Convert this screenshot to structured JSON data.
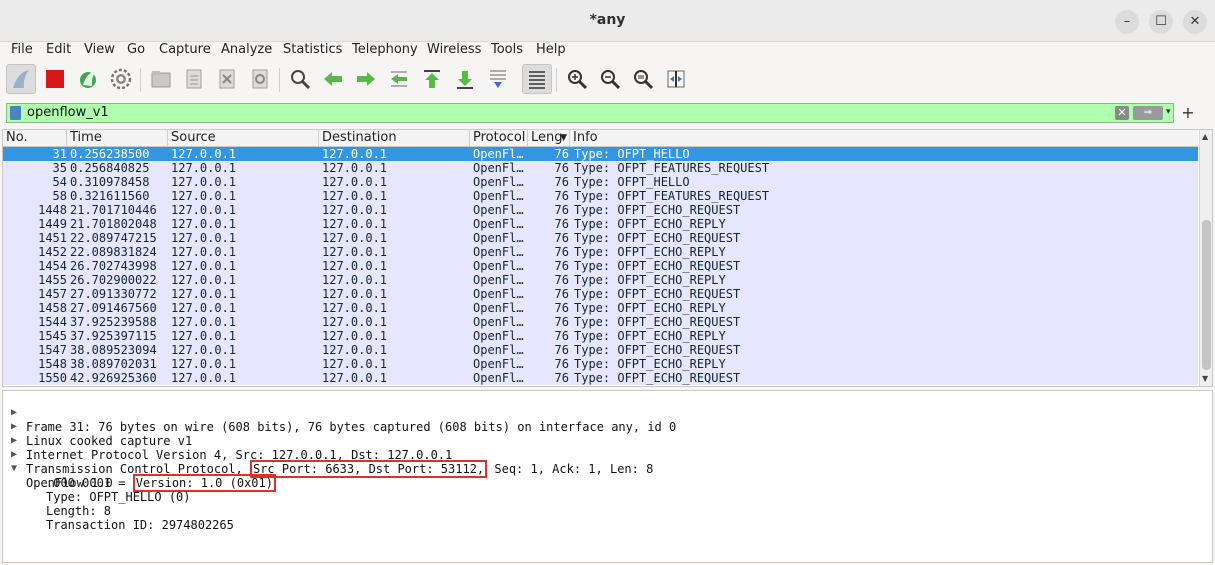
{
  "window": {
    "title": "*any",
    "minimize": "–",
    "maximize": "☐",
    "close": "✕"
  },
  "menu": [
    "File",
    "Edit",
    "View",
    "Go",
    "Capture",
    "Analyze",
    "Statistics",
    "Telephony",
    "Wireless",
    "Tools",
    "Help"
  ],
  "toolbar_icons": [
    "shark-fin-start-icon",
    "stop-square-icon",
    "restart-icon",
    "capture-options-gear-icon",
    "open-folder-icon",
    "save-file-icon",
    "close-file-icon",
    "reload-icon",
    "find-magnifier-icon",
    "go-back-icon",
    "go-forward-icon",
    "go-to-packet-icon",
    "first-packet-icon",
    "last-packet-icon",
    "autoscroll-icon",
    "colorize-icon",
    "zoom-in-icon",
    "zoom-out-icon",
    "zoom-normal-icon",
    "resize-columns-icon"
  ],
  "filter": {
    "value": "openflow_v1",
    "clear": "✕",
    "apply": "⇒",
    "dropdown": "▾",
    "add": "+"
  },
  "columns": [
    "No.",
    "Time",
    "Source",
    "Destination",
    "Protocol",
    "Leng",
    "Info"
  ],
  "rows": [
    {
      "no": "31",
      "time": "0.256238500",
      "src": "127.0.0.1",
      "dst": "127.0.0.1",
      "proto": "OpenFl…",
      "len": "76",
      "info": "Type: OFPT_HELLO",
      "selected": true
    },
    {
      "no": "35",
      "time": "0.256840825",
      "src": "127.0.0.1",
      "dst": "127.0.0.1",
      "proto": "OpenFl…",
      "len": "76",
      "info": "Type: OFPT_FEATURES_REQUEST"
    },
    {
      "no": "54",
      "time": "0.310978458",
      "src": "127.0.0.1",
      "dst": "127.0.0.1",
      "proto": "OpenFl…",
      "len": "76",
      "info": "Type: OFPT_HELLO"
    },
    {
      "no": "58",
      "time": "0.321611560",
      "src": "127.0.0.1",
      "dst": "127.0.0.1",
      "proto": "OpenFl…",
      "len": "76",
      "info": "Type: OFPT_FEATURES_REQUEST"
    },
    {
      "no": "1448",
      "time": "21.701710446",
      "src": "127.0.0.1",
      "dst": "127.0.0.1",
      "proto": "OpenFl…",
      "len": "76",
      "info": "Type: OFPT_ECHO_REQUEST"
    },
    {
      "no": "1449",
      "time": "21.701802048",
      "src": "127.0.0.1",
      "dst": "127.0.0.1",
      "proto": "OpenFl…",
      "len": "76",
      "info": "Type: OFPT_ECHO_REPLY"
    },
    {
      "no": "1451",
      "time": "22.089747215",
      "src": "127.0.0.1",
      "dst": "127.0.0.1",
      "proto": "OpenFl…",
      "len": "76",
      "info": "Type: OFPT_ECHO_REQUEST"
    },
    {
      "no": "1452",
      "time": "22.089831824",
      "src": "127.0.0.1",
      "dst": "127.0.0.1",
      "proto": "OpenFl…",
      "len": "76",
      "info": "Type: OFPT_ECHO_REPLY"
    },
    {
      "no": "1454",
      "time": "26.702743998",
      "src": "127.0.0.1",
      "dst": "127.0.0.1",
      "proto": "OpenFl…",
      "len": "76",
      "info": "Type: OFPT_ECHO_REQUEST"
    },
    {
      "no": "1455",
      "time": "26.702900022",
      "src": "127.0.0.1",
      "dst": "127.0.0.1",
      "proto": "OpenFl…",
      "len": "76",
      "info": "Type: OFPT_ECHO_REPLY"
    },
    {
      "no": "1457",
      "time": "27.091330772",
      "src": "127.0.0.1",
      "dst": "127.0.0.1",
      "proto": "OpenFl…",
      "len": "76",
      "info": "Type: OFPT_ECHO_REQUEST"
    },
    {
      "no": "1458",
      "time": "27.091467560",
      "src": "127.0.0.1",
      "dst": "127.0.0.1",
      "proto": "OpenFl…",
      "len": "76",
      "info": "Type: OFPT_ECHO_REPLY"
    },
    {
      "no": "1544",
      "time": "37.925239588",
      "src": "127.0.0.1",
      "dst": "127.0.0.1",
      "proto": "OpenFl…",
      "len": "76",
      "info": "Type: OFPT_ECHO_REQUEST"
    },
    {
      "no": "1545",
      "time": "37.925397115",
      "src": "127.0.0.1",
      "dst": "127.0.0.1",
      "proto": "OpenFl…",
      "len": "76",
      "info": "Type: OFPT_ECHO_REPLY"
    },
    {
      "no": "1547",
      "time": "38.089523094",
      "src": "127.0.0.1",
      "dst": "127.0.0.1",
      "proto": "OpenFl…",
      "len": "76",
      "info": "Type: OFPT_ECHO_REQUEST"
    },
    {
      "no": "1548",
      "time": "38.089702031",
      "src": "127.0.0.1",
      "dst": "127.0.0.1",
      "proto": "OpenFl…",
      "len": "76",
      "info": "Type: OFPT_ECHO_REPLY"
    },
    {
      "no": "1550",
      "time": "42.926925360",
      "src": "127.0.0.1",
      "dst": "127.0.0.1",
      "proto": "OpenFl…",
      "len": "76",
      "info": "Type: OFPT_ECHO_REQUEST"
    }
  ],
  "details": {
    "frame": "Frame 31: 76 bytes on wire (608 bits), 76 bytes captured (608 bits) on interface any, id 0",
    "linux": "Linux cooked capture v1",
    "ip": "Internet Protocol Version 4, Src: 127.0.0.1, Dst: 127.0.0.1",
    "tcp_prefix": "Transmission Control Protocol, ",
    "tcp_ports": "Src Port: 6633, Dst Port: 53112,",
    "tcp_suffix": " Seq: 1, Ack: 1, Len: 8",
    "openflow": "OpenFlow 1.0",
    "version_bits": ".000 0001 = ",
    "version": "Version: 1.0 (0x01)",
    "type": "Type: OFPT_HELLO (0)",
    "length": "Length: 8",
    "xid": "Transaction ID: 2974802265"
  },
  "colors": {
    "selected_row": "#3296e0",
    "openflow_row": "#e7e6ff",
    "filter_valid": "#afffaf",
    "highlight_box": "#e0302c"
  }
}
